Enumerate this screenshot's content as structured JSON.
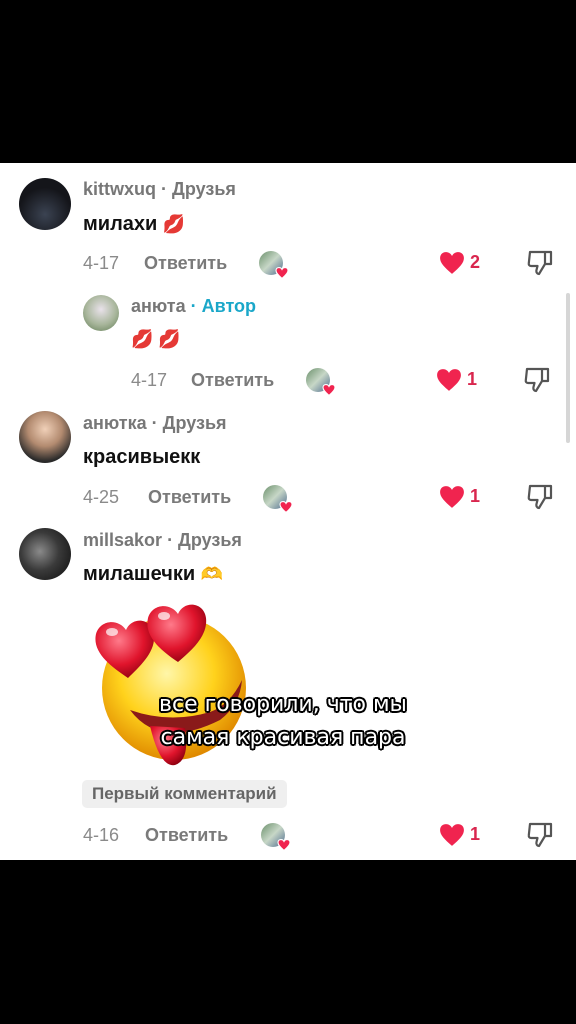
{
  "comments": [
    {
      "username": "kittwxuq",
      "relation": "· Друзья",
      "text": "милахи",
      "emoji": "💋",
      "date": "4-17",
      "reply": "Ответить",
      "likes": "2",
      "avatar_color": "#1b1c22"
    },
    {
      "username": "анюта",
      "relation": "· Автор",
      "text": "",
      "emoji": "💋 💋",
      "date": "4-17",
      "reply": "Ответить",
      "likes": "1",
      "avatar_color": "#8aa07a"
    },
    {
      "username": "анютка",
      "relation": "· Друзья",
      "text": "красивыекк",
      "emoji": "",
      "date": "4-25",
      "reply": "Ответить",
      "likes": "1",
      "avatar_color": "#b89a82"
    },
    {
      "username": "millsakor",
      "relation": "· Друзья",
      "text": "милашечки",
      "emoji": "🫶",
      "date": "4-16",
      "reply": "Ответить",
      "likes": "1",
      "avatar_color": "#3a3a3a"
    }
  ],
  "first_comment_badge": "Первый комментарий",
  "caption": {
    "line1": "все говорили, что мы",
    "line2": "самая красивая пара"
  },
  "colors": {
    "like": "#f0244f",
    "author": "#1aa7c9"
  }
}
